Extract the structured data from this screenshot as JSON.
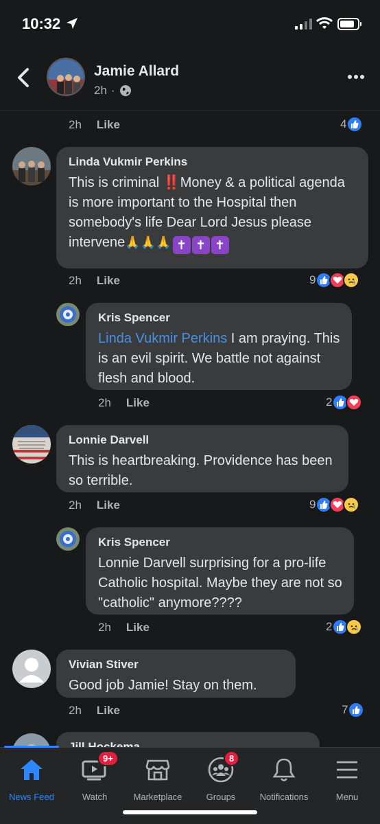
{
  "status_bar": {
    "time": "10:32"
  },
  "header": {
    "name": "Jamie Allard",
    "time": "2h",
    "separator": "·"
  },
  "comments": [
    {
      "time": "2h",
      "like": "Like",
      "reaction_count": "4"
    },
    {
      "author": "Linda Vukmir Perkins",
      "text_a": "This is criminal ",
      "text_b": "Money & a political agenda is more important to the Hospital then somebody's life Dear Lord Jesus please intervene",
      "emoji_bang": "‼️",
      "emoji_pray": "🙏🙏🙏",
      "emoji_cross": "✝",
      "time": "2h",
      "like": "Like",
      "reaction_count": "9"
    },
    {
      "author": "Kris Spencer",
      "mention": "Linda Vukmir Perkins",
      "text": " I am praying. This is an evil spirit. We battle not against flesh and blood.",
      "time": "2h",
      "like": "Like",
      "reaction_count": "2"
    },
    {
      "author": "Lonnie Darvell",
      "text": "This is heartbreaking.  Providence has been so terrible.",
      "time": "2h",
      "like": "Like",
      "reaction_count": "9"
    },
    {
      "author": "Kris Spencer",
      "text": "Lonnie Darvell surprising for a pro-life Catholic hospital. Maybe they are not so \"catholic\" anymore????",
      "time": "2h",
      "like": "Like",
      "reaction_count": "2"
    },
    {
      "author": "Vivian Stiver",
      "text": "Good job Jamie! Stay on them.",
      "time": "2h",
      "like": "Like",
      "reaction_count": "7"
    },
    {
      "author": "Jill Hockema"
    }
  ],
  "tabs": [
    {
      "label": "News Feed",
      "icon": "home-icon"
    },
    {
      "label": "Watch",
      "icon": "video-icon",
      "badge": "9+"
    },
    {
      "label": "Marketplace",
      "icon": "store-icon"
    },
    {
      "label": "Groups",
      "icon": "groups-icon",
      "badge": "8"
    },
    {
      "label": "Notifications",
      "icon": "bell-icon"
    },
    {
      "label": "Menu",
      "icon": "menu-icon"
    }
  ],
  "colors": {
    "background": "#18191a",
    "bubble": "#3a3b3c",
    "accent": "#2d88ff",
    "mention": "#4a90e2"
  }
}
